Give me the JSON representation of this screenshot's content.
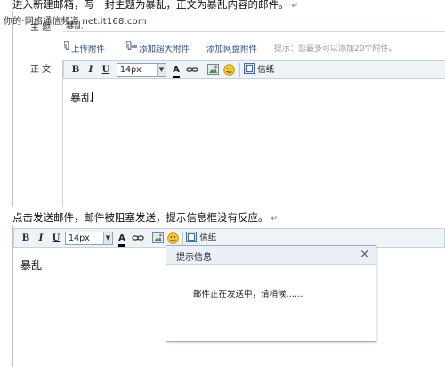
{
  "caption_top": "进入新建邮箱，写一封主题为暴乱，正文为暴乱内容的邮件。",
  "watermark": "你的·网络通信频道 net.it168.com",
  "compose": {
    "subject_label": "主  题",
    "subject_value": "暴乱",
    "attach_upload": "上传附件",
    "attach_large": "添加超大附件",
    "attach_cloud": "添加网盘附件",
    "attach_hint": "提示：您最多可以添加20个附件。",
    "body_label": "正  文",
    "body_text": "暴乱"
  },
  "toolbar": {
    "bold": "B",
    "italic": "I",
    "underline": "U",
    "font_size": "14px",
    "font_color_glyph": "A",
    "letterhead": "信纸"
  },
  "caption_middle": "点击发送邮件，邮件被阻塞发送，提示信息框没有反应。",
  "editor2": {
    "body_text": "暴乱"
  },
  "dialog": {
    "title": "提示信息",
    "close": "×",
    "message": "邮件正在发送中，请稍候……"
  },
  "return_mark": "↵",
  "icons": {
    "font_color": "font-color-icon",
    "link": "link-icon",
    "image": "image-icon",
    "emoticon": "emoticon-icon",
    "letterhead": "letterhead-icon",
    "paperclip": "paperclip-icon"
  },
  "colors": {
    "link_blue": "#2a4f8f",
    "toolbar_bg": "#eef3f8",
    "border": "#c6d2de"
  }
}
